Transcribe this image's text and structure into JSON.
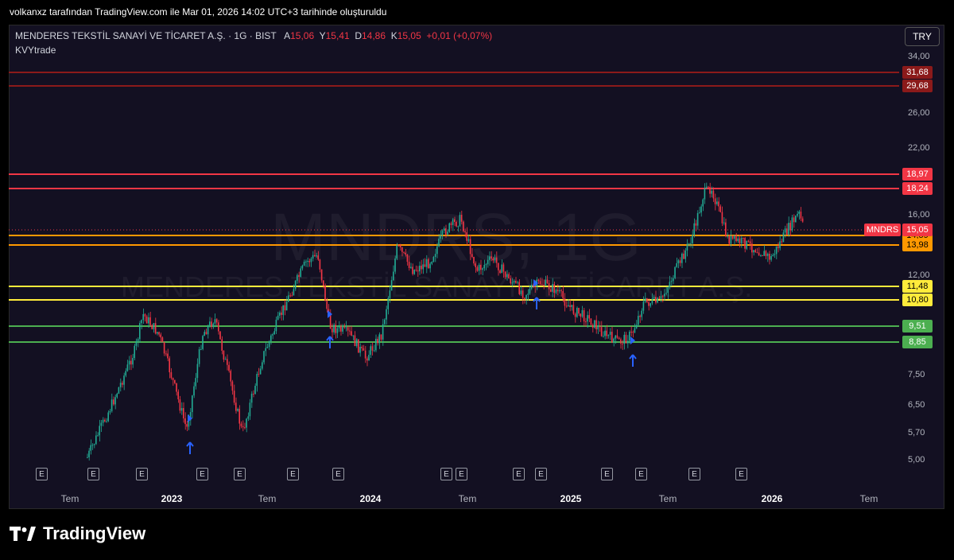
{
  "header": {
    "caption": "volkanxz tarafından TradingView.com ile Mar 01, 2026 14:02 UTC+3 tarihinde oluşturuldu"
  },
  "legend": {
    "symbol": "MENDERES TEKSTİL SANAYİ VE TİCARET A.Ş. · 1G · BIST",
    "o_label": "A",
    "o_value": "15,06",
    "h_label": "Y",
    "h_value": "15,41",
    "l_label": "D",
    "l_value": "14,86",
    "c_label": "K",
    "c_value": "15,05",
    "change": "+0,01 (+0,07%)",
    "indicator": "KVYtrade"
  },
  "currency": "TRY",
  "watermark": {
    "ticker": "MNDRS, 1G",
    "name": "MENDERES TEKSTİL SANAYİ VE TİCARET A.Ş."
  },
  "price_axis": [
    "34,00",
    "26,00",
    "22,00",
    "16,00",
    "12,00",
    "7,50",
    "6,50",
    "5,70",
    "5,00"
  ],
  "time_axis": [
    {
      "label": "Tem",
      "year": false
    },
    {
      "label": "2023",
      "year": true
    },
    {
      "label": "Tem",
      "year": false
    },
    {
      "label": "2024",
      "year": true
    },
    {
      "label": "Tem",
      "year": false
    },
    {
      "label": "2025",
      "year": true
    },
    {
      "label": "Tem",
      "year": false
    },
    {
      "label": "2026",
      "year": true
    },
    {
      "label": "Tem",
      "year": false
    }
  ],
  "levels": [
    {
      "label": "31,68",
      "color": "#8b1a1a"
    },
    {
      "label": "29,68",
      "color": "#8b1a1a"
    },
    {
      "label": "18,97",
      "color": "#f23645"
    },
    {
      "label": "18,24",
      "color": "#f23645"
    },
    {
      "label": "14,59",
      "color": "#ff9800"
    },
    {
      "label": "13,98",
      "color": "#ff9800"
    },
    {
      "label": "11,48",
      "color": "#ffeb3b"
    },
    {
      "label": "10,80",
      "color": "#ffeb3b"
    },
    {
      "label": "9,51",
      "color": "#4caf50"
    },
    {
      "label": "8,85",
      "color": "#4caf50"
    }
  ],
  "last_price": {
    "ticker": "MNDRS",
    "value": "15,05"
  },
  "earnings_marker": "E",
  "logo_text": "TradingView"
}
